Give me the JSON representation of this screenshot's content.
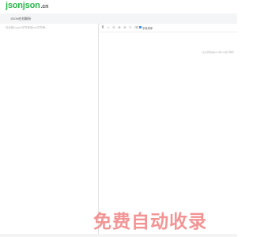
{
  "header": {
    "logo_main": "jsonjson",
    "logo_suffix": ".cn"
  },
  "nav": {
    "item": "JSON在线解析"
  },
  "left_editor": {
    "placeholder": "在此输入json字符串或xml字符串..."
  },
  "right_toolbar": {
    "icons": [
      "format-icon",
      "compress-icon",
      "copy-icon",
      "expand-icon",
      "collapse-icon",
      "edit-icon",
      "delete-icon"
    ],
    "glyphs": [
      "≣",
      "≡",
      "⎘",
      "⊞",
      "⊟",
      "✎",
      "⌫"
    ],
    "checkbox_label": "字段排序",
    "checkbox_checked": true
  },
  "right_view": {
    "hint": "在左侧粘贴json或xml进行解析"
  },
  "watermark": {
    "text": "免费自动收录"
  },
  "colors": {
    "brand_green": "#2ab64a",
    "checkbox_blue": "#3b8fe8",
    "watermark_red": "#f28282"
  }
}
